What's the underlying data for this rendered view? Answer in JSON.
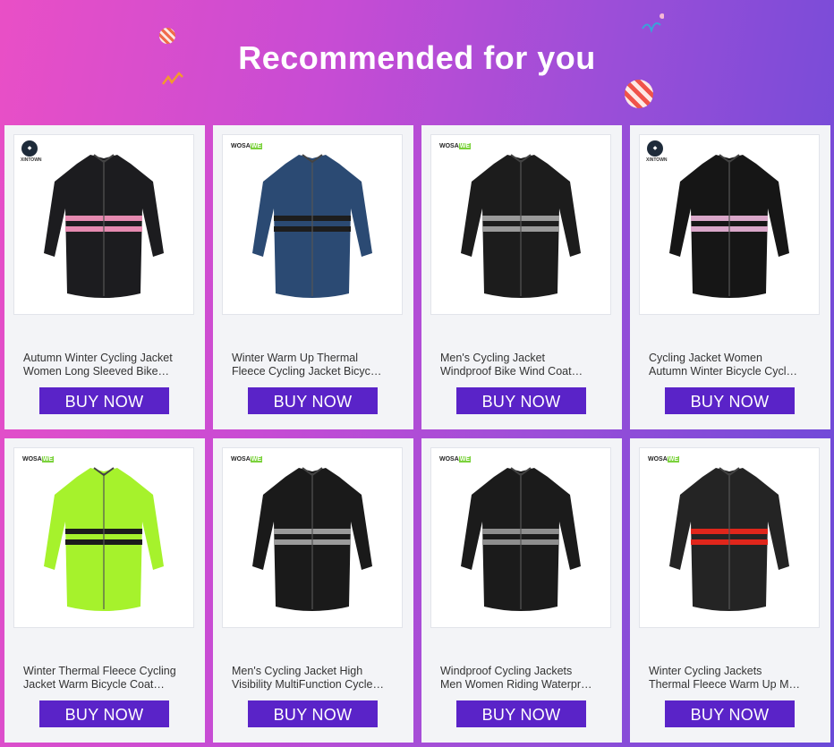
{
  "header": {
    "title": "Recommended for you"
  },
  "products": [
    {
      "line1": "Autumn Winter Cycling Jacket",
      "line2": "Women Long Sleeved Bike…",
      "button": "BUY NOW",
      "brand": "XINTOWN",
      "colors": [
        "#1c1c1f",
        "#e58ab0",
        "#bfbfc4"
      ]
    },
    {
      "line1": "Winter Warm Up Thermal",
      "line2": "Fleece Cycling Jacket Bicyc…",
      "button": "BUY NOW",
      "brand": "WOSAWE",
      "colors": [
        "#2b4a73",
        "#1d1d1d",
        "#8a2233",
        "#9cf02e"
      ]
    },
    {
      "line1": "Men's Cycling Jacket",
      "line2": "Windproof Bike Wind Coat…",
      "button": "BUY NOW",
      "brand": "WOSAWE",
      "colors": [
        "#1c1c1c",
        "#9a9a9a"
      ]
    },
    {
      "line1": "Cycling Jacket Women",
      "line2": "Autumn Winter Bicycle Cycl…",
      "button": "BUY NOW",
      "brand": "XINTOWN",
      "colors": [
        "#161616",
        "#d9a7c9",
        "#7ec6a8"
      ]
    },
    {
      "line1": "Winter Thermal Fleece Cycling",
      "line2": "Jacket Warm Bicycle Coat…",
      "button": "BUY NOW",
      "brand": "WOSAWE",
      "colors": [
        "#a6f22c",
        "#1c1c1c"
      ]
    },
    {
      "line1": "Men's Cycling Jacket High",
      "line2": "Visibility MultiFunction Cycle…",
      "button": "BUY NOW",
      "brand": "WOSAWE",
      "colors": [
        "#1a1a1a",
        "#9b9b9b"
      ]
    },
    {
      "line1": "Windproof Cycling Jackets",
      "line2": "Men Women Riding Waterpr…",
      "button": "BUY NOW",
      "brand": "WOSAWE",
      "colors": [
        "#1b1b1b",
        "#8e8e8e"
      ]
    },
    {
      "line1": "Winter Cycling Jackets",
      "line2": "Thermal Fleece Warm Up M…",
      "button": "BUY NOW",
      "brand": "WOSAWE",
      "colors": [
        "#242424",
        "#e0261b"
      ]
    }
  ],
  "theme": {
    "button_color": "#5a23c8",
    "card_bg": "#f3f4f7"
  }
}
